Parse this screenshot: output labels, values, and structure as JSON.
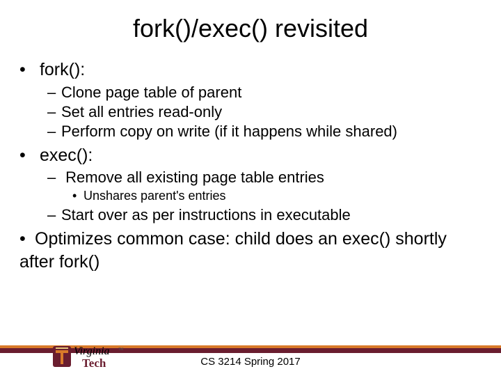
{
  "title": "fork()/exec() revisited",
  "bullets": {
    "b1": "fork():",
    "b1_1": "Clone page table of parent",
    "b1_2": "Set all entries read-only",
    "b1_3": "Perform copy on write (if it happens while shared)",
    "b2": "exec():",
    "b2_1": "Remove all existing page table entries",
    "b2_1_1": "Unshares parent's entries",
    "b2_2": "Start over as per instructions in executable",
    "b3": "Optimizes common case: child does an exec() shortly after fork()"
  },
  "footer": {
    "course": "CS 3214 Spring 2017",
    "logo_text1": "Virginia",
    "logo_text2": "Tech"
  }
}
